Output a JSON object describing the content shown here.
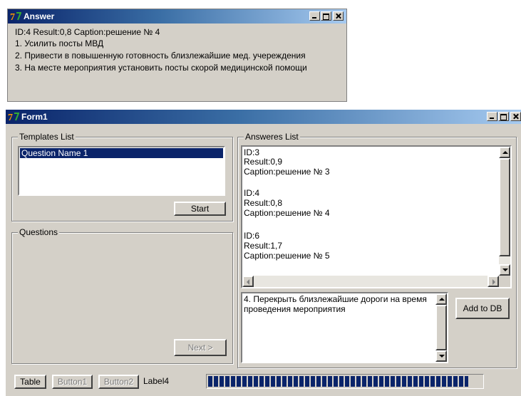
{
  "answer_window": {
    "title": "Answer",
    "lines": [
      "ID:4  Result:0,8  Caption:решение № 4",
      "1. Усилить посты МВД",
      "2. Привести в повышенную готовность близлежайшие мед. учереждения",
      "3. На месте мероприятия установить посты скорой медицинской помощи"
    ]
  },
  "form_window": {
    "title": "Form1",
    "templates_group": {
      "label": "Templates List",
      "items": [
        "Question Name 1"
      ],
      "start_button": "Start"
    },
    "questions_group": {
      "label": "Questions",
      "next_button": "Next >"
    },
    "answers_group": {
      "label": "Answeres List",
      "memo_lines": [
        "ID:3",
        "Result:0,9",
        "Caption:решение № 3",
        "",
        "ID:4",
        "Result:0,8",
        "Caption:решение № 4",
        "",
        "ID:6",
        "Result:1,7",
        "Caption:решение № 5"
      ],
      "input_lines": [
        "4. Перекрыть близлежайшие дороги на время",
        "проведения мероприятия"
      ],
      "add_button": "Add to DB"
    },
    "bottom": {
      "table_button": "Table",
      "button1": "Button1",
      "button2": "Button2",
      "label4": "Label4",
      "progress": 0.95
    }
  }
}
